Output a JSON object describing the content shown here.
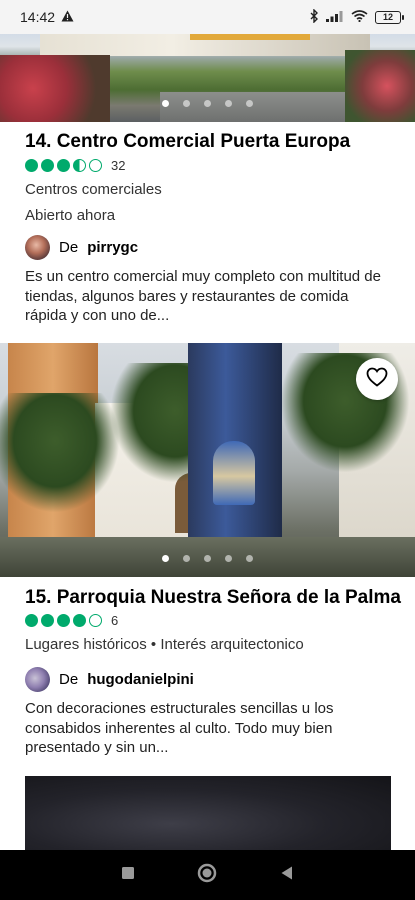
{
  "status": {
    "time": "14:42",
    "battery": "12"
  },
  "listings": [
    {
      "title": "14. Centro Comercial Puerta Europa",
      "rating": 3.5,
      "reviews": "32",
      "category": "Centros comerciales",
      "hours": "Abierto ahora",
      "author_prefix": "De",
      "author": "pirrygc",
      "review": "Es un centro comercial muy completo con multitud de tiendas, algunos bares y restaurantes de comida rápida y con uno de..."
    },
    {
      "title": "15. Parroquia Nuestra Señora de la Palma",
      "rating": 4,
      "reviews": "6",
      "category": "Lugares históricos • Interés arquitectonico",
      "author_prefix": "De",
      "author": "hugodanielpini",
      "review": "Con decoraciones estructurales sencillas u los consabidos inherentes al culto. Todo muy bien presentado y sin un..."
    }
  ],
  "colors": {
    "rating_green": "#00aa6c"
  },
  "icons": {
    "save": "heart-icon",
    "nav_recents": "square-icon",
    "nav_home": "circle-icon",
    "nav_back": "triangle-back-icon"
  }
}
